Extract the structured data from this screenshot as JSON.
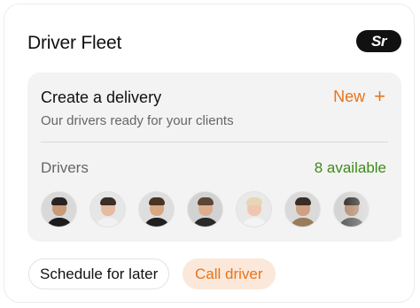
{
  "header": {
    "title": "Driver Fleet",
    "logo_text": "Sr"
  },
  "delivery": {
    "title": "Create a delivery",
    "new_label": "New",
    "subtitle": "Our drivers ready for your clients"
  },
  "drivers": {
    "label": "Drivers",
    "available_text": "8 available",
    "avatars": [
      {
        "bg": "#d9d9d9",
        "skin": "#c99a78",
        "hair": "#2a2321",
        "shirt": "#1c1c1c"
      },
      {
        "bg": "#e6e6e6",
        "skin": "#e5bca0",
        "hair": "#3b2f28",
        "shirt": "#f1f1f1"
      },
      {
        "bg": "#dedede",
        "skin": "#d8a882",
        "hair": "#4a3424",
        "shirt": "#202020"
      },
      {
        "bg": "#d2d2d2",
        "skin": "#dcae8f",
        "hair": "#5c4635",
        "shirt": "#2b2b2b"
      },
      {
        "bg": "#e9e9e9",
        "skin": "#f0c7ae",
        "hair": "#e7d5b7",
        "shirt": "#f4f4f4"
      },
      {
        "bg": "#dadada",
        "skin": "#cfa084",
        "hair": "#3a2d25",
        "shirt": "#9a7c5c"
      },
      {
        "bg": "#d4d4d4",
        "skin": "#b58b6c",
        "hair": "#2f2a26",
        "shirt": "#5a5a5a"
      }
    ]
  },
  "actions": {
    "schedule_label": "Schedule for later",
    "call_label": "Call driver"
  },
  "colors": {
    "accent": "#e8741b",
    "available": "#3d8a1c"
  }
}
